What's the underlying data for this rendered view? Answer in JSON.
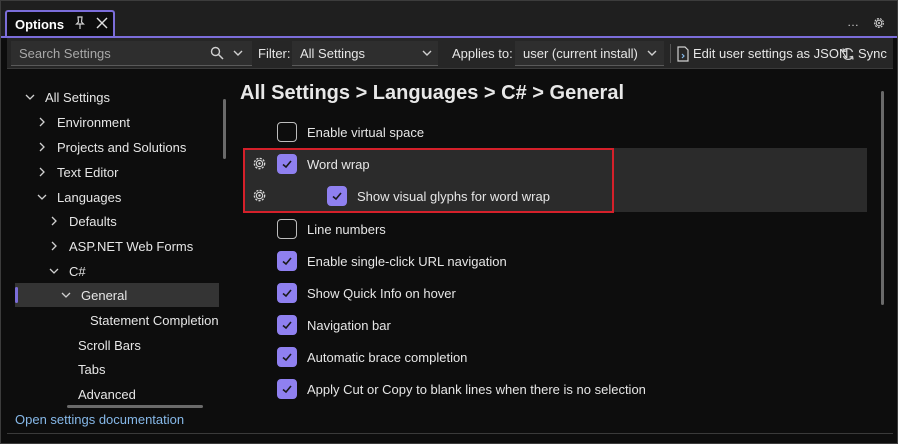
{
  "window": {
    "tab_title": "Options",
    "more_label": "…"
  },
  "toolbar": {
    "search_placeholder": "Search Settings",
    "filter_label": "Filter:",
    "filter_value": "All Settings",
    "applies_label": "Applies to:",
    "applies_value": "user (current install)",
    "edit_json_label": "Edit user settings as JSON",
    "sync_label": "Sync"
  },
  "nav": {
    "items": [
      {
        "label": "All Settings",
        "chevron": "down"
      },
      {
        "label": "Environment",
        "chevron": "right"
      },
      {
        "label": "Projects and Solutions",
        "chevron": "right"
      },
      {
        "label": "Text Editor",
        "chevron": "right"
      },
      {
        "label": "Languages",
        "chevron": "down"
      },
      {
        "label": "Defaults",
        "chevron": "right"
      },
      {
        "label": "ASP.NET Web Forms",
        "chevron": "right"
      },
      {
        "label": "C#",
        "chevron": "down"
      },
      {
        "label": "General",
        "chevron": "down",
        "selected": true
      },
      {
        "label": "Statement Completion",
        "chevron": "none"
      },
      {
        "label": "Scroll Bars",
        "chevron": "none"
      },
      {
        "label": "Tabs",
        "chevron": "none"
      },
      {
        "label": "Advanced",
        "chevron": "none"
      }
    ],
    "docs_link": "Open settings documentation"
  },
  "main": {
    "breadcrumb": "All Settings > Languages > C# > General",
    "settings": [
      {
        "label": "Enable virtual space",
        "checked": false
      },
      {
        "label": "Word wrap",
        "checked": true
      },
      {
        "label": "Show visual glyphs for word wrap",
        "checked": true
      },
      {
        "label": "Line numbers",
        "checked": false
      },
      {
        "label": "Enable single-click URL navigation",
        "checked": true
      },
      {
        "label": "Show Quick Info on hover",
        "checked": true
      },
      {
        "label": "Navigation bar",
        "checked": true
      },
      {
        "label": "Automatic brace completion",
        "checked": true
      },
      {
        "label": "Apply Cut or Copy to blank lines when there is no selection",
        "checked": true
      }
    ]
  },
  "colors": {
    "accent": "#7b6dd9",
    "checkbox_on": "#8f80f0",
    "highlight_border": "#d5202a",
    "link": "#86b8e8"
  },
  "icons": [
    "pin-icon",
    "close-icon",
    "more-icon",
    "gear-icon",
    "search-icon",
    "chevron-down-icon",
    "chevron-right-icon",
    "json-file-icon",
    "sync-icon",
    "check-icon"
  ]
}
